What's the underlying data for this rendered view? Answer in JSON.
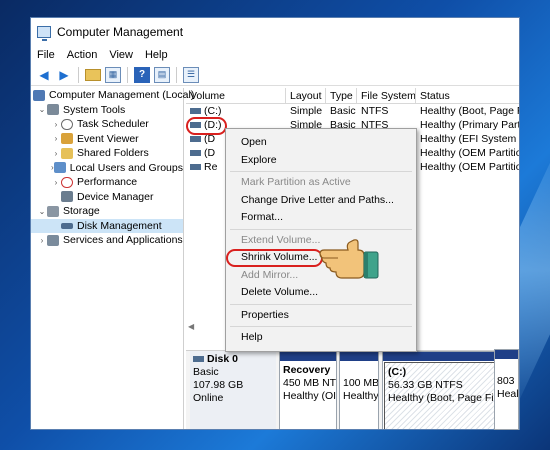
{
  "window": {
    "title": "Computer Management"
  },
  "menu": [
    "File",
    "Action",
    "View",
    "Help"
  ],
  "toolbar": [
    "back-icon",
    "forward-icon",
    "up-folder-icon",
    "properties-icon",
    "help-icon",
    "show-hide-icon",
    "export-icon"
  ],
  "tree": [
    {
      "label": "Computer Management (Local)",
      "icon": "computer-management-icon",
      "expander": "collapse"
    },
    {
      "label": "System Tools",
      "icon": "tools-icon",
      "expander": "collapse"
    },
    {
      "label": "Task Scheduler",
      "icon": "clock-icon",
      "expander": "expand"
    },
    {
      "label": "Event Viewer",
      "icon": "event-viewer-icon",
      "expander": "expand"
    },
    {
      "label": "Shared Folders",
      "icon": "shared-folder-icon",
      "expander": "expand"
    },
    {
      "label": "Local Users and Groups",
      "icon": "users-icon",
      "expander": "expand"
    },
    {
      "label": "Performance",
      "icon": "performance-icon",
      "expander": "expand"
    },
    {
      "label": "Device Manager",
      "icon": "device-manager-icon",
      "expander": ""
    },
    {
      "label": "Storage",
      "icon": "storage-icon",
      "expander": "collapse"
    },
    {
      "label": "Disk Management",
      "icon": "disk-icon",
      "expander": ""
    },
    {
      "label": "Services and Applications",
      "icon": "services-icon",
      "expander": "expand"
    }
  ],
  "volume_list": {
    "headers": [
      "Volume",
      "Layout",
      "Type",
      "File System",
      "Status"
    ],
    "rows": [
      [
        "(C:)",
        "Simple",
        "Basic",
        "NTFS",
        "Healthy (Boot, Page Fil"
      ],
      [
        "(D:)",
        "Simple",
        "Basic",
        "NTFS",
        "Healthy (Primary Partitio"
      ],
      [
        "(D",
        "",
        "",
        "",
        "Healthy (EFI System Par"
      ],
      [
        "(D",
        "",
        "",
        "",
        "Healthy (OEM Partition)"
      ],
      [
        "Re",
        "",
        "",
        "",
        "Healthy (OEM Partition)"
      ]
    ]
  },
  "disk": {
    "name": "Disk 0",
    "type": "Basic",
    "size": "107.98 GB",
    "state": "Online",
    "partitions": [
      {
        "name": "Recovery",
        "line1": "450 MB NT",
        "line2": "Healthy (OI"
      },
      {
        "name": "",
        "line1": "100 MB",
        "line2": "Healthy"
      },
      {
        "name": "(C:)",
        "line1": "56.33 GB NTFS",
        "line2": "Healthy (Boot, Page Fi"
      },
      {
        "name": "",
        "line1": "803 M",
        "line2": "Healt"
      }
    ]
  },
  "context_menu": [
    {
      "label": "Open",
      "enabled": true
    },
    {
      "label": "Explore",
      "enabled": true
    },
    {
      "sep": true
    },
    {
      "label": "Mark Partition as Active",
      "enabled": false
    },
    {
      "label": "Change Drive Letter and Paths...",
      "enabled": true
    },
    {
      "label": "Format...",
      "enabled": true
    },
    {
      "sep": true
    },
    {
      "label": "Extend Volume...",
      "enabled": false
    },
    {
      "label": "Shrink Volume...",
      "enabled": true,
      "highlighted": true
    },
    {
      "label": "Add Mirror...",
      "enabled": false
    },
    {
      "label": "Delete Volume...",
      "enabled": true
    },
    {
      "sep": true
    },
    {
      "label": "Properties",
      "enabled": true
    },
    {
      "sep": true
    },
    {
      "label": "Help",
      "enabled": true
    }
  ],
  "annotation": {
    "color": "#d9201e",
    "pointer": "pointing-hand-icon"
  }
}
